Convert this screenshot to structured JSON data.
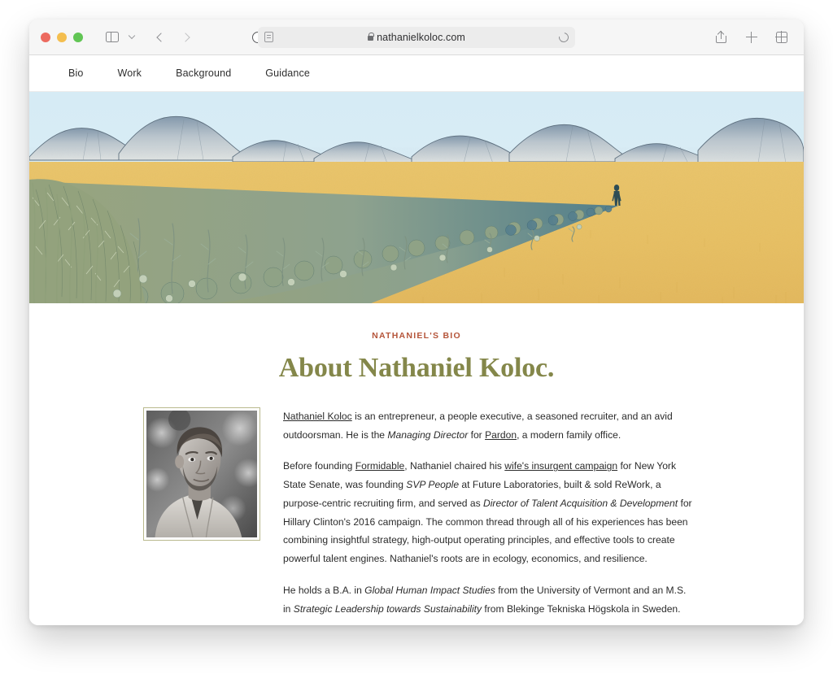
{
  "browser": {
    "url": "nathanielkoloc.com",
    "secure": true,
    "controls": {
      "close": "close-window",
      "minimize": "minimize-window",
      "maximize": "maximize-window",
      "sidebar": "Sidebar",
      "sidebar_menu": "Sidebar options",
      "back": "Back",
      "forward": "Forward",
      "reader": "Reader view",
      "reload": "Reload",
      "contrast": "Website settings",
      "share": "Share",
      "new_tab": "New Tab",
      "tab_overview": "Tab Overview"
    }
  },
  "site": {
    "nav": [
      {
        "label": "Bio"
      },
      {
        "label": "Work"
      },
      {
        "label": "Background"
      },
      {
        "label": "Guidance"
      }
    ],
    "hero": {
      "alt": "Illustrated landscape: a lone figure walking through a golden field toward the sun, with sage-green foliage in the foreground and grey-blue mountains on the horizon",
      "colors": {
        "sky": "#d9ecf4",
        "field": "#e8c166",
        "mountain": "#8fa3b4",
        "foliage": "#8d9b7a",
        "foliage_deep": "#4f7e8c",
        "sun": "#e89a2b",
        "figure": "#2e4d55"
      }
    },
    "bio": {
      "eyebrow": "NATHANIEL'S BIO",
      "title": "About Nathaniel Koloc.",
      "portrait_alt": "Black and white portrait photograph of Nathaniel Koloc outdoors",
      "paragraph1": {
        "link_name": "Nathaniel Koloc",
        "part1": " is an entrepreneur, a people executive, a seasoned recruiter, and an avid outdoorsman. He is the ",
        "role": "Managing Director",
        "part2": " for ",
        "link_company": "Pardon",
        "part3": ", a modern family office."
      },
      "paragraph2": {
        "part1": "Before founding ",
        "link_formidable": "Formidable",
        "part2": ", Nathaniel chaired his ",
        "link_campaign": "wife's insurgent campaign",
        "part3": " for New York State Senate, was founding ",
        "role1": "SVP People",
        "part4": " at Future Laboratories, built & sold ReWork, a purpose-centric recruiting firm, and served as ",
        "role2": "Director of Talent Acquisition & Development",
        "part5": " for Hillary Clinton's 2016 campaign. The common thread through all of his experiences has been combining insightful strategy, high-output operating principles, and effective tools to create powerful talent engines. Nathaniel's roots are in ecology, economics, and resilience."
      },
      "paragraph3": {
        "part1": "He holds a B.A. in ",
        "degree1": "Global Human Impact Studies",
        "part2": " from the University of Vermont and an M.S. in ",
        "degree2": "Strategic Leadership towards Sustainability",
        "part3": " from Blekinge Tekniska Högskola in Sweden."
      }
    },
    "theme": {
      "eyebrow_color": "#b5553a",
      "title_color": "#84874a",
      "footer_color": "#e3d5b9",
      "portrait_border": "#b9b98d"
    }
  }
}
